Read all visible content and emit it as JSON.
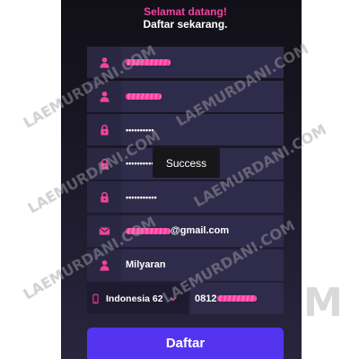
{
  "header": {
    "greeting": "Selamat datang!",
    "subtitle": "Daftar sekarang."
  },
  "fields": [
    {
      "icon": "user-icon"
    },
    {
      "icon": "user-icon"
    },
    {
      "icon": "lock-icon",
      "value": "••••••••••"
    },
    {
      "icon": "lock-icon",
      "value": "••••••••••"
    },
    {
      "icon": "lock-icon",
      "value": "•••••••••••"
    },
    {
      "icon": "envelope-icon",
      "value": "@gmail.com"
    },
    {
      "icon": "user-icon",
      "value": "Milyaran"
    }
  ],
  "phone": {
    "icon": "phone-icon",
    "country_code": "Indonesia 62",
    "dropdown_icon": "chevron-down-icon",
    "number": "0812"
  },
  "toast": {
    "message": "Success"
  },
  "submit": {
    "label": "Daftar"
  },
  "watermark": {
    "text": "LAEMURDANI.COM",
    "logo_letter": "M"
  },
  "colors": {
    "accent": "#f0449c",
    "button": "#5534f0",
    "field": "#2f2b4a",
    "icon_box": "#2a2742",
    "background": "#ffffff"
  }
}
